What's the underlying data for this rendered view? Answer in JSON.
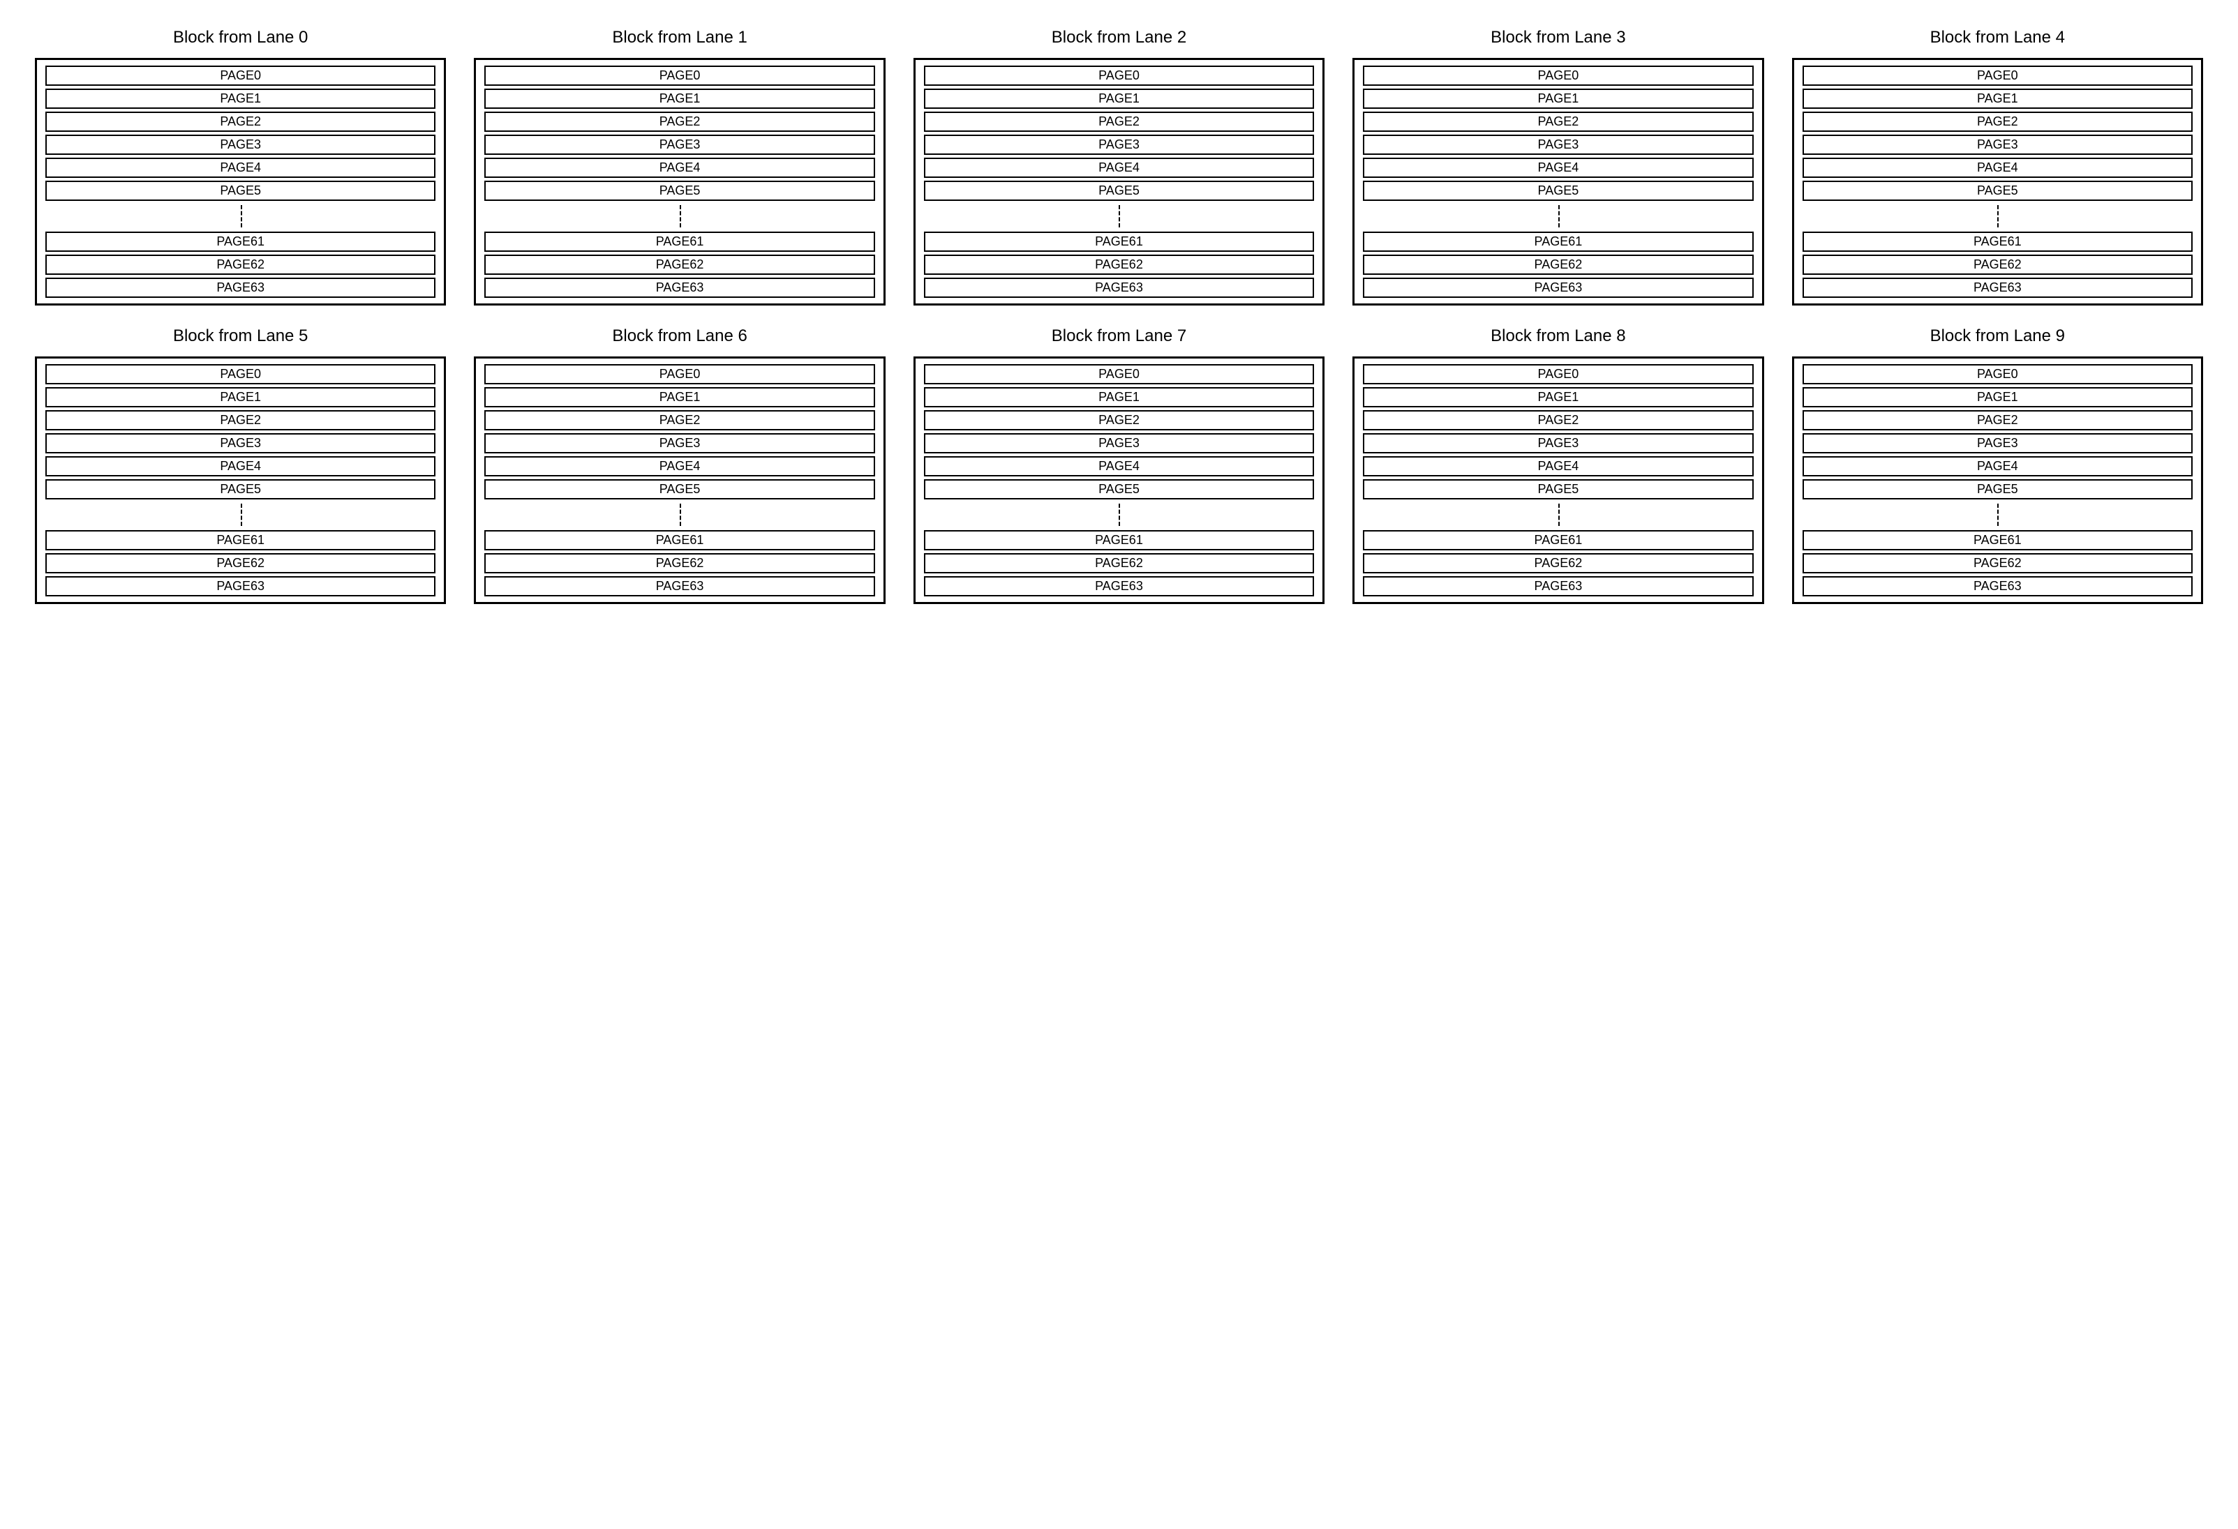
{
  "lanes": [
    {
      "title": "Block from Lane 0"
    },
    {
      "title": "Block from Lane 1"
    },
    {
      "title": "Block from Lane 2"
    },
    {
      "title": "Block from Lane 3"
    },
    {
      "title": "Block from Lane 4"
    },
    {
      "title": "Block from Lane 5"
    },
    {
      "title": "Block from Lane 6"
    },
    {
      "title": "Block from Lane 7"
    },
    {
      "title": "Block from Lane 8"
    },
    {
      "title": "Block from Lane 9"
    }
  ],
  "pages_top": [
    "PAGE0",
    "PAGE1",
    "PAGE2",
    "PAGE3",
    "PAGE4",
    "PAGE5"
  ],
  "pages_bottom": [
    "PAGE61",
    "PAGE62",
    "PAGE63"
  ]
}
